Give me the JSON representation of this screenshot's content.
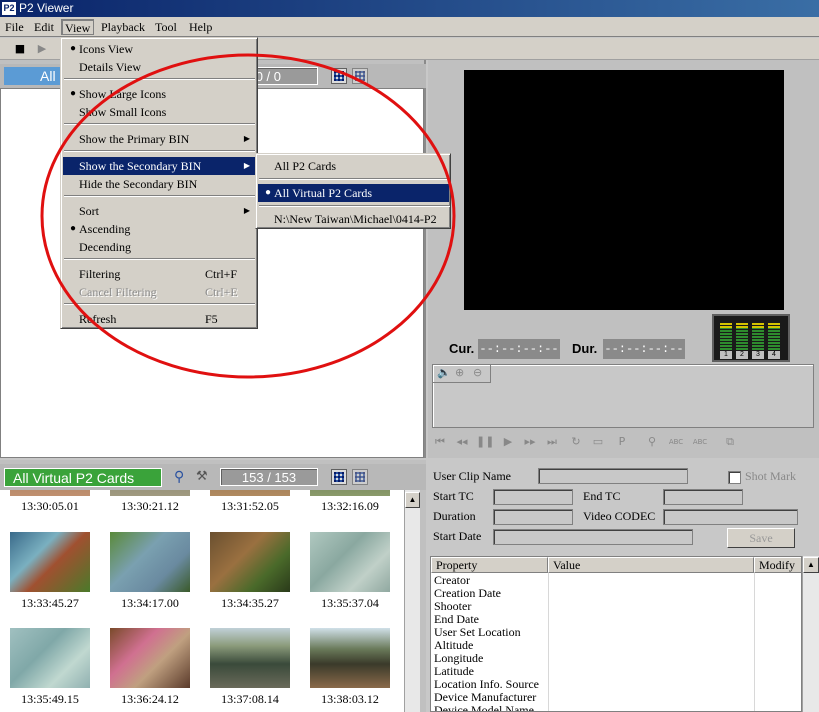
{
  "window": {
    "title": "P2 Viewer",
    "app_icon": "p2-app-icon"
  },
  "menubar": [
    "File",
    "Edit",
    "View",
    "Playback",
    "Tool",
    "Help"
  ],
  "top_bin": {
    "label": "All",
    "counter": "0 / 0"
  },
  "view_menu": {
    "items": [
      {
        "label": "Icons View",
        "bullet": true
      },
      {
        "label": "Details View"
      },
      {
        "label": "Show Large Icons",
        "bullet": true
      },
      {
        "label": "Show Small Icons"
      },
      {
        "label": "Show the Primary BIN",
        "submenu": true
      },
      {
        "label": "Show the Secondary BIN",
        "submenu": true,
        "highlighted": true
      },
      {
        "label": "Hide the Secondary BIN"
      },
      {
        "label": "Sort",
        "submenu": true
      },
      {
        "label": "Ascending",
        "bullet": true
      },
      {
        "label": "Decending"
      },
      {
        "label": "Filtering",
        "shortcut": "Ctrl+F"
      },
      {
        "label": "Cancel Filtering",
        "shortcut": "Ctrl+E",
        "disabled": true
      },
      {
        "label": "Refresh",
        "shortcut": "F5"
      }
    ]
  },
  "secondary_bin_submenu": {
    "items": [
      {
        "label": "All P2 Cards"
      },
      {
        "label": "All Virtual P2 Cards",
        "bullet": true,
        "highlighted": true
      },
      {
        "label": "N:\\New Taiwan\\Michael\\0414-P2"
      }
    ]
  },
  "preview": {
    "cur_label": "Cur.",
    "cur_value": "--:--:--:--",
    "dur_label": "Dur.",
    "dur_value": "--:--:--:--",
    "meter_channels": [
      "1",
      "2",
      "3",
      "4"
    ]
  },
  "secondary_bin": {
    "name": "All Virtual P2 Cards",
    "counter": "153 / 153",
    "clips": [
      {
        "time": "13:30:05.01"
      },
      {
        "time": "13:30:21.12"
      },
      {
        "time": "13:31:52.05"
      },
      {
        "time": "13:32:16.09"
      },
      {
        "time": "13:33:45.27"
      },
      {
        "time": "13:34:17.00"
      },
      {
        "time": "13:34:35.27"
      },
      {
        "time": "13:35:37.04"
      },
      {
        "time": "13:35:49.15"
      },
      {
        "time": "13:36:24.12"
      },
      {
        "time": "13:37:08.14"
      },
      {
        "time": "13:38:03.12"
      }
    ]
  },
  "clip_info": {
    "user_clip_name": "User Clip Name",
    "shot_mark": "Shot Mark",
    "start_tc": "Start TC",
    "end_tc": "End TC",
    "duration": "Duration",
    "video_codec": "Video CODEC",
    "start_date": "Start Date",
    "save": "Save"
  },
  "properties": {
    "headers": [
      "Property",
      "Value",
      "Modify"
    ],
    "rows": [
      "Creator",
      "Creation Date",
      "Shooter",
      "End Date",
      "User Set Location",
      "Altitude",
      "Longitude",
      "Latitude",
      "Location Info. Source",
      "Device Manufacturer",
      "Device Model Name"
    ]
  },
  "colors": {
    "title_bar": "#0a246a",
    "highlight": "#0a246a",
    "bin_green": "#3aa33a",
    "annotation_red": "#e01010",
    "preview_bg": "#000000"
  }
}
